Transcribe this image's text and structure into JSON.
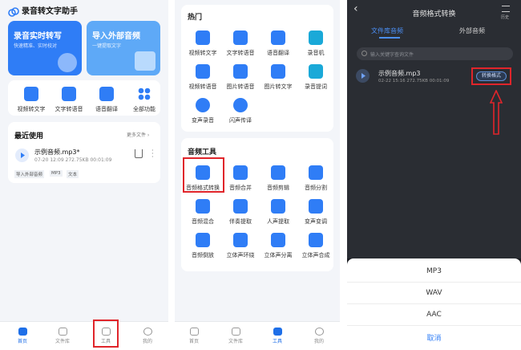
{
  "panel1": {
    "app_title": "录音转文字助手",
    "banner_left": {
      "title": "录音实时转写",
      "subtitle": "快速精准、实时校对"
    },
    "banner_right": {
      "title": "导入外部音频",
      "subtitle": "一键提取文字"
    },
    "quick_tools": [
      "视频转文字",
      "文字转语音",
      "语音翻译",
      "全部功能"
    ],
    "recent": {
      "title": "最近使用",
      "more": "更多文件 ›",
      "file_name": "示例音频.mp3*",
      "file_meta": "07-20 12:09   272.75KB   00:01:09",
      "tags": [
        "导入外部音频",
        "MP3",
        "文本"
      ]
    },
    "nav": [
      "首页",
      "文件库",
      "工具",
      "我的"
    ]
  },
  "panel2": {
    "hot_title": "热门",
    "hot_tools": [
      "视频转文字",
      "文字转语音",
      "语音翻译",
      "录音机",
      "视频转语音",
      "图片转语音",
      "图片转文字",
      "录音提词",
      "变声录音",
      "闪声传译"
    ],
    "audio_title": "音频工具",
    "audio_tools": [
      "音频格式转换",
      "音频合并",
      "音频剪辑",
      "音频分割",
      "音频混合",
      "伴奏提取",
      "人声提取",
      "变声变调",
      "音频倒放",
      "立体声环绕",
      "立体声分离",
      "立体声合成"
    ],
    "nav": [
      "首页",
      "文件库",
      "工具",
      "我的"
    ]
  },
  "panel3": {
    "title": "音频格式转换",
    "back": "‹",
    "history": "历史",
    "tabs": [
      "文件库音频",
      "外部音频"
    ],
    "search_placeholder": "输入关键字查询文件",
    "file_name": "示例音频.mp3",
    "file_meta": "02-22 15:16   272.75KB   00:01:09",
    "convert_button": "转换格式",
    "formats": [
      "MP3",
      "WAV",
      "AAC"
    ],
    "cancel": "取消"
  },
  "colors": {
    "accent": "#2f7df6",
    "annotation_red": "#e0252b"
  }
}
